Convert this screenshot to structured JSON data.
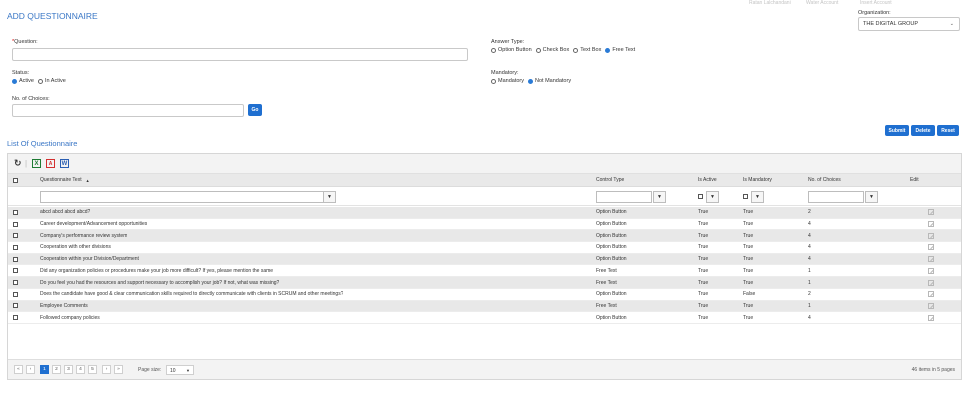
{
  "page": {
    "title": "ADD QUESTIONNAIRE"
  },
  "top_faint": [
    "Ratan Lalchandani",
    "Water Account",
    "Insert Account"
  ],
  "organization": {
    "label": "Organization:",
    "selected": "THE DIGITAL GROUP"
  },
  "form": {
    "question_label": "Question:",
    "question_required_mark": "*",
    "question_value": "",
    "answer_type_label": "Answer Type:",
    "answer_types": [
      {
        "label": "Option Button",
        "selected": false
      },
      {
        "label": "Check Box",
        "selected": false
      },
      {
        "label": "Text Box",
        "selected": false
      },
      {
        "label": "Free Text",
        "selected": true
      }
    ],
    "status_label": "Status:",
    "statuses": [
      {
        "label": "Active",
        "selected": true
      },
      {
        "label": "In Active",
        "selected": false
      }
    ],
    "mandatory_label": "Mandatory:",
    "mandatory_options": [
      {
        "label": "Mandatory",
        "selected": false
      },
      {
        "label": "Not Mandatory",
        "selected": true
      }
    ],
    "choices_label": "No. of Choices:",
    "choices_value": "",
    "go_label": "Go"
  },
  "actions": {
    "submit": "Submit",
    "delete": "Delete",
    "reset": "Reset"
  },
  "list": {
    "title": "List Of Questionnaire",
    "toolbar_icons": [
      "refresh-icon",
      "excel-icon",
      "pdf-icon",
      "word-icon"
    ],
    "columns": [
      "Questionnaire Text",
      "Control Type",
      "Is Active",
      "Is Mandatory",
      "No. of Choices",
      "Edit"
    ],
    "sort_indicator": "▲",
    "filter_icon": "▼",
    "rows": [
      {
        "text": "abcd abcd abcd abcd?",
        "control": "Option Button",
        "active": "True",
        "mandatory": "True",
        "choices": "2"
      },
      {
        "text": "Career development/Advancement opportunities",
        "control": "Option Button",
        "active": "True",
        "mandatory": "True",
        "choices": "4"
      },
      {
        "text": "Company's performance review system",
        "control": "Option Button",
        "active": "True",
        "mandatory": "True",
        "choices": "4"
      },
      {
        "text": "Cooperation with other divisions",
        "control": "Option Button",
        "active": "True",
        "mandatory": "True",
        "choices": "4"
      },
      {
        "text": "Cooperation within your Division/Department",
        "control": "Option Button",
        "active": "True",
        "mandatory": "True",
        "choices": "4"
      },
      {
        "text": "Did any organization policies or procedures make your job more difficult? If yes, please mention the same",
        "control": "Free Text",
        "active": "True",
        "mandatory": "True",
        "choices": "1"
      },
      {
        "text": "Do you feel you had the resources and support necessary to accomplish your job? If not, what was missing?",
        "control": "Free Text",
        "active": "True",
        "mandatory": "True",
        "choices": "1"
      },
      {
        "text": "Does the candidate have good & clear communication skills required to directly communicate with clients in SCRUM and other meetings?",
        "control": "Option Button",
        "active": "True",
        "mandatory": "False",
        "choices": "2"
      },
      {
        "text": "Employee Comments",
        "control": "Free Text",
        "active": "True",
        "mandatory": "True",
        "choices": "1"
      },
      {
        "text": "Followed company policies",
        "control": "Option Button",
        "active": "True",
        "mandatory": "True",
        "choices": "4"
      }
    ],
    "pager": {
      "first": "«",
      "prev": "‹",
      "pages": [
        "1",
        "2",
        "3",
        "4",
        "5"
      ],
      "current": "1",
      "next": "›",
      "last": "»",
      "page_size_label": "Page size:",
      "page_size": "10",
      "items_info": "46 items in 5 pages"
    }
  },
  "colors": {
    "accent": "#1f6fd0",
    "title": "#3a77c6",
    "radio_on": "#2a7bd6",
    "excel": "#1e7b34",
    "pdf": "#d32f2f",
    "word": "#2b5fb3"
  }
}
